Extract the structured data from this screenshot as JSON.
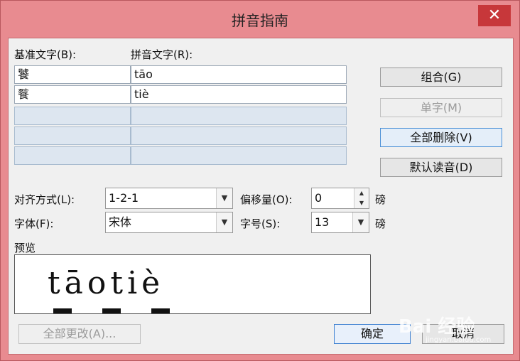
{
  "window": {
    "title": "拼音指南",
    "close_glyph": "✕"
  },
  "table": {
    "base_header": "基准文字(B):",
    "ruby_header": "拼音文字(R):",
    "rows": [
      {
        "base": "饕",
        "ruby": "tāo"
      },
      {
        "base": "餮",
        "ruby": "tiè"
      },
      {
        "base": "",
        "ruby": ""
      },
      {
        "base": "",
        "ruby": ""
      },
      {
        "base": "",
        "ruby": ""
      }
    ]
  },
  "buttons": {
    "group": "组合(G)",
    "single": "单字(M)",
    "delete_all": "全部删除(V)",
    "default_reading": "默认读音(D)",
    "apply_all": "全部更改(A)...",
    "ok": "确定",
    "cancel": "取消"
  },
  "options": {
    "align_label": "对齐方式(L):",
    "align_value": "1-2-1",
    "font_label": "字体(F):",
    "font_value": "宋体",
    "offset_label": "偏移量(O):",
    "offset_value": "0",
    "offset_unit": "磅",
    "size_label": "字号(S):",
    "size_value": "13",
    "size_unit": "磅"
  },
  "preview": {
    "label": "预览",
    "text": "tāotiè"
  },
  "watermark": {
    "main": "Bai 经验",
    "sub": "jingyan.baidu.com"
  }
}
